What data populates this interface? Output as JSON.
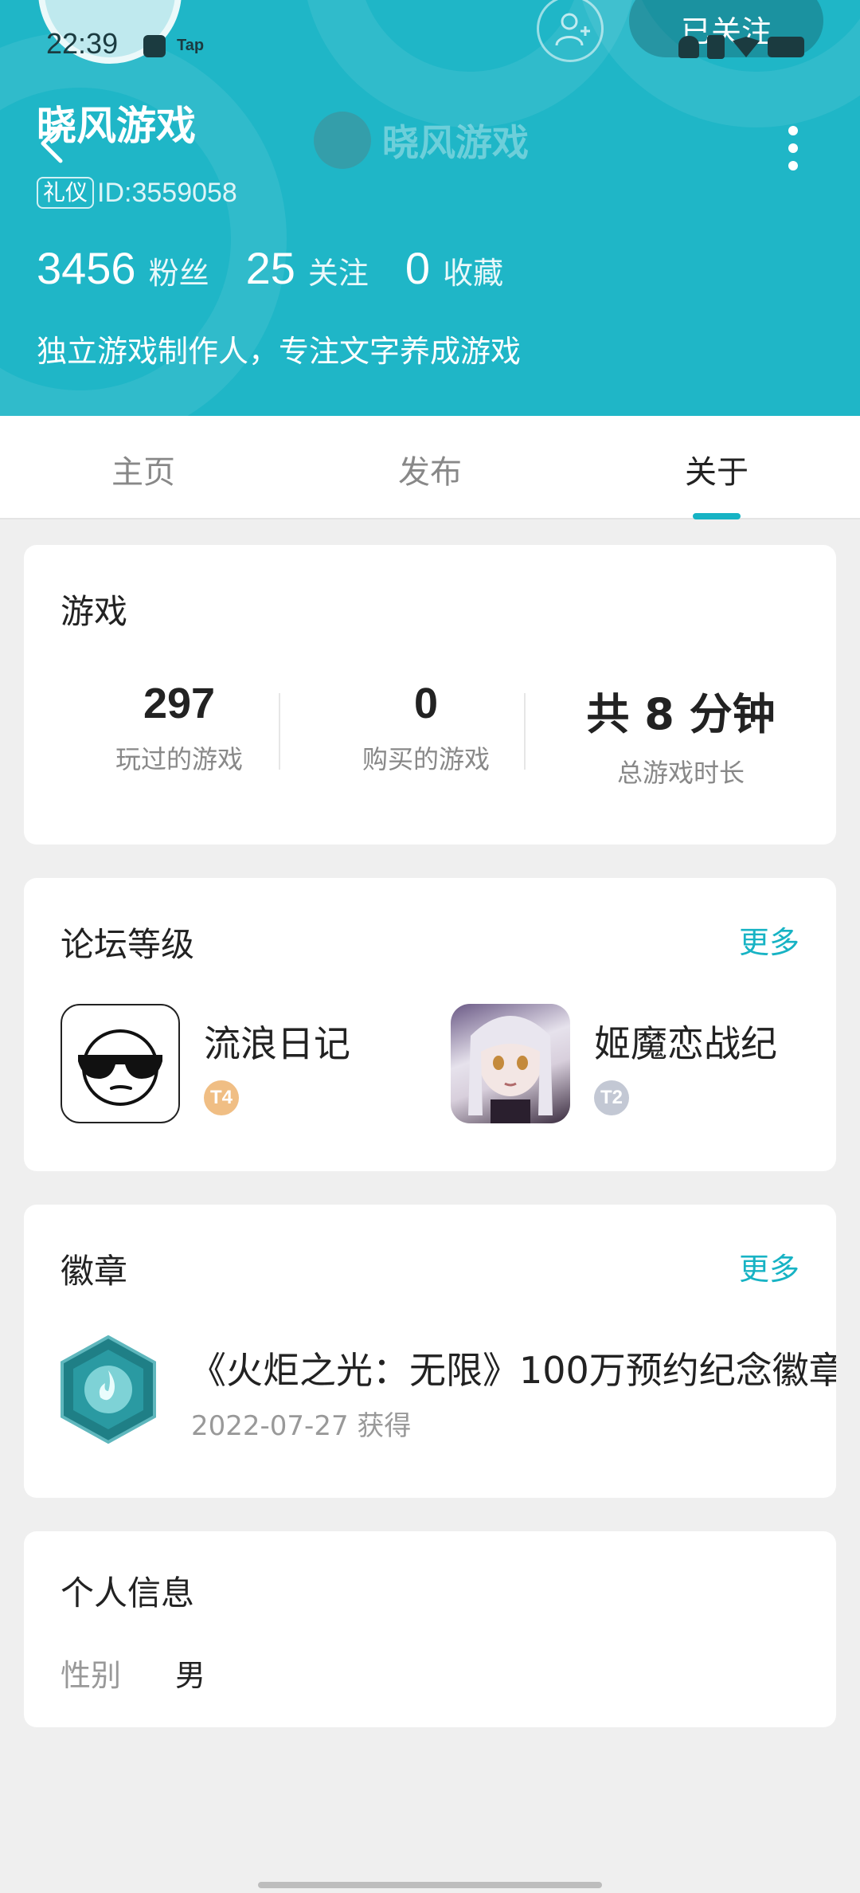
{
  "status_bar": {
    "time": "22:39",
    "app_label": "Tap"
  },
  "header": {
    "username": "晓风游戏",
    "center_title": "晓风游戏",
    "etiquette_badge": "礼仪",
    "user_id": "ID:3559058",
    "follow_label": "已关注",
    "stats": [
      {
        "value": "3456",
        "label": "粉丝"
      },
      {
        "value": "25",
        "label": "关注"
      },
      {
        "value": "0",
        "label": "收藏"
      }
    ],
    "bio": "独立游戏制作人，专注文字养成游戏",
    "icons": {
      "back": "back-arrow-icon",
      "more": "more-vertical-icon",
      "add_friend": "add-friend-icon"
    },
    "accent_color": "#1fb6c7"
  },
  "tabs": [
    {
      "label": "主页",
      "active": false
    },
    {
      "label": "发布",
      "active": false
    },
    {
      "label": "关于",
      "active": true
    }
  ],
  "games": {
    "title": "游戏",
    "stats": [
      {
        "value": "297",
        "label": "玩过的游戏"
      },
      {
        "value": "0",
        "label": "购买的游戏"
      },
      {
        "value": "共 8 分钟",
        "label": "总游戏时长"
      }
    ]
  },
  "forum": {
    "title": "论坛等级",
    "more": "更多",
    "items": [
      {
        "name": "流浪日记",
        "level": "T4",
        "icon": "sunglasses-face-icon"
      },
      {
        "name": "姬魔恋战纪",
        "level": "T2",
        "icon": "anime-girl-icon"
      }
    ]
  },
  "badges": {
    "title": "徽章",
    "more": "更多",
    "items": [
      {
        "name": "《火炬之光：无限》100万预约纪念徽章",
        "date": "2022-07-27",
        "obtained_label": "获得",
        "icon": "hexagon-badge-icon"
      }
    ]
  },
  "personal_info": {
    "title": "个人信息",
    "rows": [
      {
        "label": "性别",
        "value": "男"
      }
    ]
  }
}
